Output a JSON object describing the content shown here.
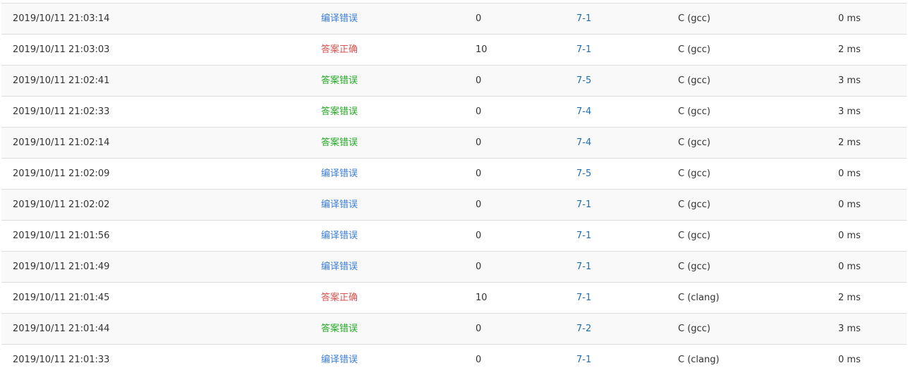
{
  "colors": {
    "compile_error": "#3b7dd8",
    "accepted": "#d9534f",
    "wrong_answer": "#23a923",
    "problem_link": "#1f6fb5",
    "row_border": "#dddddd",
    "row_stripe": "#f9f9f9"
  },
  "rows": [
    {
      "time": "2019/10/11 21:03:14",
      "status": "编译错误",
      "status_type": "compile",
      "score": "0",
      "problem": "7-1",
      "language": "C (gcc)",
      "duration": "0 ms"
    },
    {
      "time": "2019/10/11 21:03:03",
      "status": "答案正确",
      "status_type": "accepted",
      "score": "10",
      "problem": "7-1",
      "language": "C (gcc)",
      "duration": "2 ms"
    },
    {
      "time": "2019/10/11 21:02:41",
      "status": "答案错误",
      "status_type": "wrong",
      "score": "0",
      "problem": "7-5",
      "language": "C (gcc)",
      "duration": "3 ms"
    },
    {
      "time": "2019/10/11 21:02:33",
      "status": "答案错误",
      "status_type": "wrong",
      "score": "0",
      "problem": "7-4",
      "language": "C (gcc)",
      "duration": "3 ms"
    },
    {
      "time": "2019/10/11 21:02:14",
      "status": "答案错误",
      "status_type": "wrong",
      "score": "0",
      "problem": "7-4",
      "language": "C (gcc)",
      "duration": "2 ms"
    },
    {
      "time": "2019/10/11 21:02:09",
      "status": "编译错误",
      "status_type": "compile",
      "score": "0",
      "problem": "7-5",
      "language": "C (gcc)",
      "duration": "0 ms"
    },
    {
      "time": "2019/10/11 21:02:02",
      "status": "编译错误",
      "status_type": "compile",
      "score": "0",
      "problem": "7-1",
      "language": "C (gcc)",
      "duration": "0 ms"
    },
    {
      "time": "2019/10/11 21:01:56",
      "status": "编译错误",
      "status_type": "compile",
      "score": "0",
      "problem": "7-1",
      "language": "C (gcc)",
      "duration": "0 ms"
    },
    {
      "time": "2019/10/11 21:01:49",
      "status": "编译错误",
      "status_type": "compile",
      "score": "0",
      "problem": "7-1",
      "language": "C (gcc)",
      "duration": "0 ms"
    },
    {
      "time": "2019/10/11 21:01:45",
      "status": "答案正确",
      "status_type": "accepted",
      "score": "10",
      "problem": "7-1",
      "language": "C (clang)",
      "duration": "2 ms"
    },
    {
      "time": "2019/10/11 21:01:44",
      "status": "答案错误",
      "status_type": "wrong",
      "score": "0",
      "problem": "7-2",
      "language": "C (gcc)",
      "duration": "3 ms"
    },
    {
      "time": "2019/10/11 21:01:33",
      "status": "编译错误",
      "status_type": "compile",
      "score": "0",
      "problem": "7-1",
      "language": "C (clang)",
      "duration": "0 ms"
    }
  ]
}
